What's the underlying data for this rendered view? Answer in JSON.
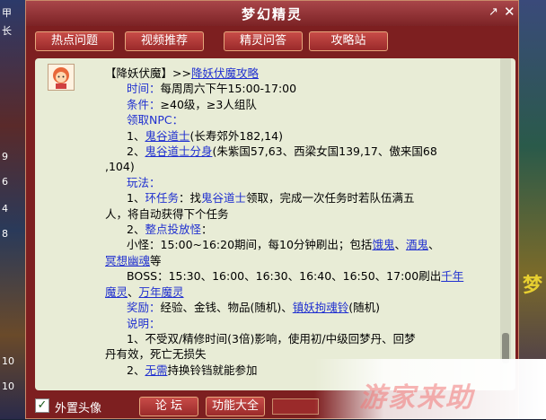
{
  "window": {
    "title": "梦幻精灵"
  },
  "tabs": [
    {
      "label": "热点问题"
    },
    {
      "label": "视频推荐"
    },
    {
      "label": "精灵问答"
    },
    {
      "label": "攻略站"
    }
  ],
  "bg": {
    "left_labels": [
      "甲",
      "长",
      "9",
      "6",
      "4",
      "8",
      "10",
      "10"
    ],
    "right_glyph": "梦"
  },
  "content": {
    "head_bracket": "【降妖伏魔】",
    "head_arrow": ">>",
    "head_link": "降妖伏魔攻略",
    "time_label": "时间：",
    "time_value": "每周周六下午15:00-17:00",
    "cond_label": "条件：",
    "cond_value": "≥40级，≥3人组队",
    "npc_label": "领取NPC：",
    "npc1_num": "1、",
    "npc1_name": "鬼谷道士",
    "npc1_loc": "(长寿郊外182,14)",
    "npc2_num": "2、",
    "npc2_name": "鬼谷道士分身",
    "npc2_loc": "(朱紫国57,63、西梁女国139,17、傲来国68",
    "npc2_loc_cont": ",104)",
    "play_label": "玩法：",
    "ring_num": "1、",
    "ring_name": "环任务",
    "ring_pre": "：找",
    "ring_npc": "鬼谷道士",
    "ring_post": "领取，完成一次任务时若队伍满五",
    "ring_cont": "人，将自动获得下个任务",
    "hour_num": "2、",
    "hour_name": "整点投放怪",
    "hour_colon": "：",
    "small_pre": "小怪：15:00~16:20期间，每10分钟刷出；包括",
    "small_m1": "饿鬼",
    "small_sep": "、",
    "small_m2": "酒鬼",
    "small_comma": "、",
    "small_m3": "冥想幽魂",
    "small_post": "等",
    "boss_pre": "BOSS：15:30、16:00、16:30、16:40、16:50、17:00刷出",
    "boss_m1": "千年",
    "boss_m1b": "魔灵",
    "boss_sep": "、",
    "boss_m2": "万年魔灵",
    "reward_label": "奖励：",
    "reward_pre": "经验、金钱、物品(随机)、",
    "reward_item": "镇妖拘魂铃",
    "reward_post": "(随机)",
    "note_label": "说明：",
    "note1": "1、不受双/精修时间(3倍)影响，使用初/中级回梦丹、回梦",
    "note1_cont": "丹有效，死亡无损失",
    "note2_num": "2、",
    "note2_link": "无需",
    "note2_text": "持换铃铛就能参加"
  },
  "bottom": {
    "checkbox_mark": "✓",
    "checkbox_label": "外置头像",
    "forum": "论 坛",
    "features": "功能大全"
  },
  "watermark": {
    "text": "游家来助"
  }
}
